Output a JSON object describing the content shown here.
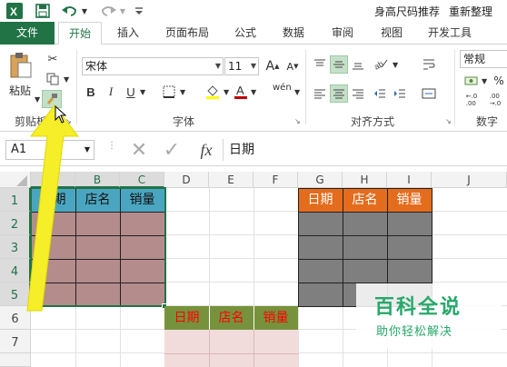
{
  "window": {
    "title_tail": "身高尺码推荐",
    "title_extra": "重新整理"
  },
  "tabs": [
    "文件",
    "开始",
    "插入",
    "页面布局",
    "公式",
    "数据",
    "审阅",
    "视图",
    "开发工具"
  ],
  "ribbon": {
    "clipboard": {
      "paste_label": "粘贴",
      "group_label": "剪贴板"
    },
    "font": {
      "name": "宋体",
      "size": "11",
      "bold": "B",
      "italic": "I",
      "underline": "U",
      "phonetic": "wén",
      "group_label": "字体"
    },
    "alignment": {
      "group_label": "对齐方式"
    },
    "number": {
      "format": "常规",
      "group_label": "数字"
    }
  },
  "formula_bar": {
    "name_box": "A1",
    "fx": "fx",
    "content": "日期"
  },
  "grid": {
    "columns": [
      "A",
      "B",
      "C",
      "D",
      "E",
      "F",
      "G",
      "H",
      "I",
      "J"
    ],
    "rows": [
      "1",
      "2",
      "3",
      "4",
      "5",
      "6",
      "7"
    ],
    "table1_headers": [
      "日期",
      "店名",
      "销量"
    ],
    "table2_headers": [
      "日期",
      "店名",
      "销量"
    ],
    "table3_headers": [
      "日期",
      "店名",
      "销量"
    ]
  },
  "colors": {
    "accent": "#217346",
    "table1_header": "#4aa6c0",
    "table1_body": "#b48c8c",
    "table2_header": "#e36c1d",
    "table2_body": "#7f7f7f",
    "table3_header": "#77923c",
    "table3_text": "#ff0000",
    "table3_body": "#f2dcdb",
    "arrow": "#f5ee28"
  },
  "watermark": {
    "title": "百科全说",
    "subtitle": "助你轻松解决"
  }
}
